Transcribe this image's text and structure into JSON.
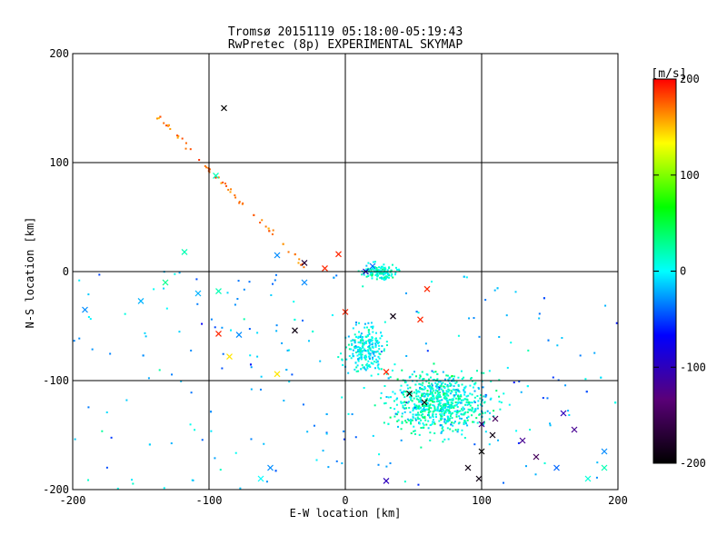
{
  "chart_data": {
    "type": "scatter",
    "title": "Tromsø 20151119 05:18:00-05:19:43",
    "subtitle": "RwPretec (8p) EXPERIMENTAL SKYMAP",
    "xlabel": "E-W location [km]",
    "ylabel": "N-S location [km]",
    "xlim": [
      -200,
      200
    ],
    "ylim": [
      -200,
      200
    ],
    "xticks": [
      -200,
      -100,
      0,
      100,
      200
    ],
    "yticks": [
      -200,
      -100,
      0,
      100,
      200
    ],
    "grid": true,
    "colorbar": {
      "label": "[m/s]",
      "min": -200,
      "max": 200,
      "ticks": [
        200,
        100,
        0,
        -100,
        -200
      ],
      "colors": [
        "#000000",
        "#5a0078",
        "#0000ff",
        "#00ffff",
        "#00ff00",
        "#ffff00",
        "#ff0000"
      ]
    },
    "series": [
      {
        "marker": "x",
        "points": [
          [
            -89,
            150
          ],
          [
            -95,
            88
          ],
          [
            -118,
            18
          ],
          [
            -132,
            -10
          ],
          [
            -108,
            -20
          ],
          [
            -93,
            -18
          ],
          [
            -150,
            -27
          ],
          [
            -191,
            -35
          ],
          [
            -93,
            -57
          ],
          [
            -78,
            -58
          ],
          [
            -85,
            -78
          ],
          [
            -50,
            15
          ],
          [
            -30,
            8
          ],
          [
            -30,
            -10
          ],
          [
            -15,
            3
          ],
          [
            -5,
            16
          ],
          [
            0,
            -37
          ],
          [
            -37,
            -54
          ],
          [
            15,
            0
          ],
          [
            20,
            5
          ],
          [
            35,
            -41
          ],
          [
            55,
            -44
          ],
          [
            60,
            -16
          ],
          [
            47,
            -112
          ],
          [
            58,
            -120
          ],
          [
            30,
            -92
          ],
          [
            -50,
            -94
          ],
          [
            -55,
            -180
          ],
          [
            -62,
            -190
          ],
          [
            30,
            -192
          ],
          [
            100,
            -140
          ],
          [
            108,
            -150
          ],
          [
            100,
            -165
          ],
          [
            98,
            -190
          ],
          [
            140,
            -170
          ],
          [
            155,
            -180
          ],
          [
            168,
            -145
          ],
          [
            190,
            -165
          ],
          [
            190,
            -180
          ],
          [
            160,
            -130
          ],
          [
            90,
            -180
          ],
          [
            110,
            -135
          ],
          [
            130,
            -155
          ],
          [
            178,
            -190
          ]
        ],
        "v": [
          -200,
          20,
          20,
          30,
          -20,
          20,
          -20,
          -30,
          190,
          -30,
          140,
          -30,
          -170,
          -30,
          190,
          190,
          190,
          -190,
          -100,
          -40,
          -190,
          190,
          190,
          -200,
          -200,
          190,
          140,
          -30,
          0,
          -100,
          -120,
          -190,
          -200,
          -190,
          -150,
          -40,
          -120,
          -30,
          20,
          -100,
          -190,
          -150,
          -120,
          10
        ]
      }
    ],
    "scatter_dots": {
      "count": 1500,
      "description_note": ""
    }
  },
  "colors": {
    "axis": "#000000",
    "background": "#ffffff"
  }
}
